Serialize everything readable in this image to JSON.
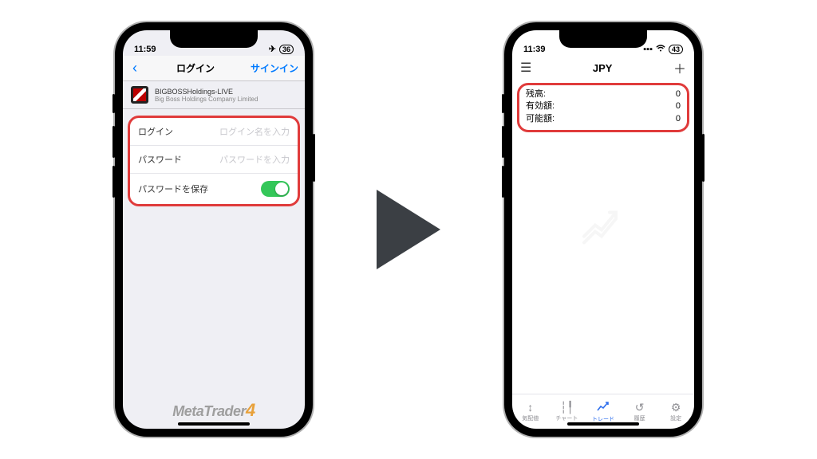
{
  "left": {
    "status": {
      "time": "11:59",
      "battery": "36"
    },
    "nav": {
      "back": "‹",
      "title": "ログイン",
      "signin": "サインイン"
    },
    "broker": {
      "name": "BIGBOSSHoldings-LIVE",
      "company": "Big Boss Holdings Company Limited"
    },
    "form": {
      "login_label": "ログイン",
      "login_placeholder": "ログイン名を入力",
      "password_label": "パスワード",
      "password_placeholder": "パスワードを入力",
      "save_label": "パスワードを保存"
    },
    "brand": {
      "name": "MetaTrader",
      "suffix": "4"
    }
  },
  "right": {
    "status": {
      "time": "11:39",
      "battery": "43"
    },
    "topbar": {
      "title": "JPY"
    },
    "balance": {
      "row1_label": "残高:",
      "row1_value": "0",
      "row2_label": "有効額:",
      "row2_value": "0",
      "row3_label": "可能額:",
      "row3_value": "0"
    },
    "tabs": {
      "t1": "気配値",
      "t2": "チャート",
      "t3": "トレード",
      "t4": "履歴",
      "t5": "設定"
    }
  }
}
